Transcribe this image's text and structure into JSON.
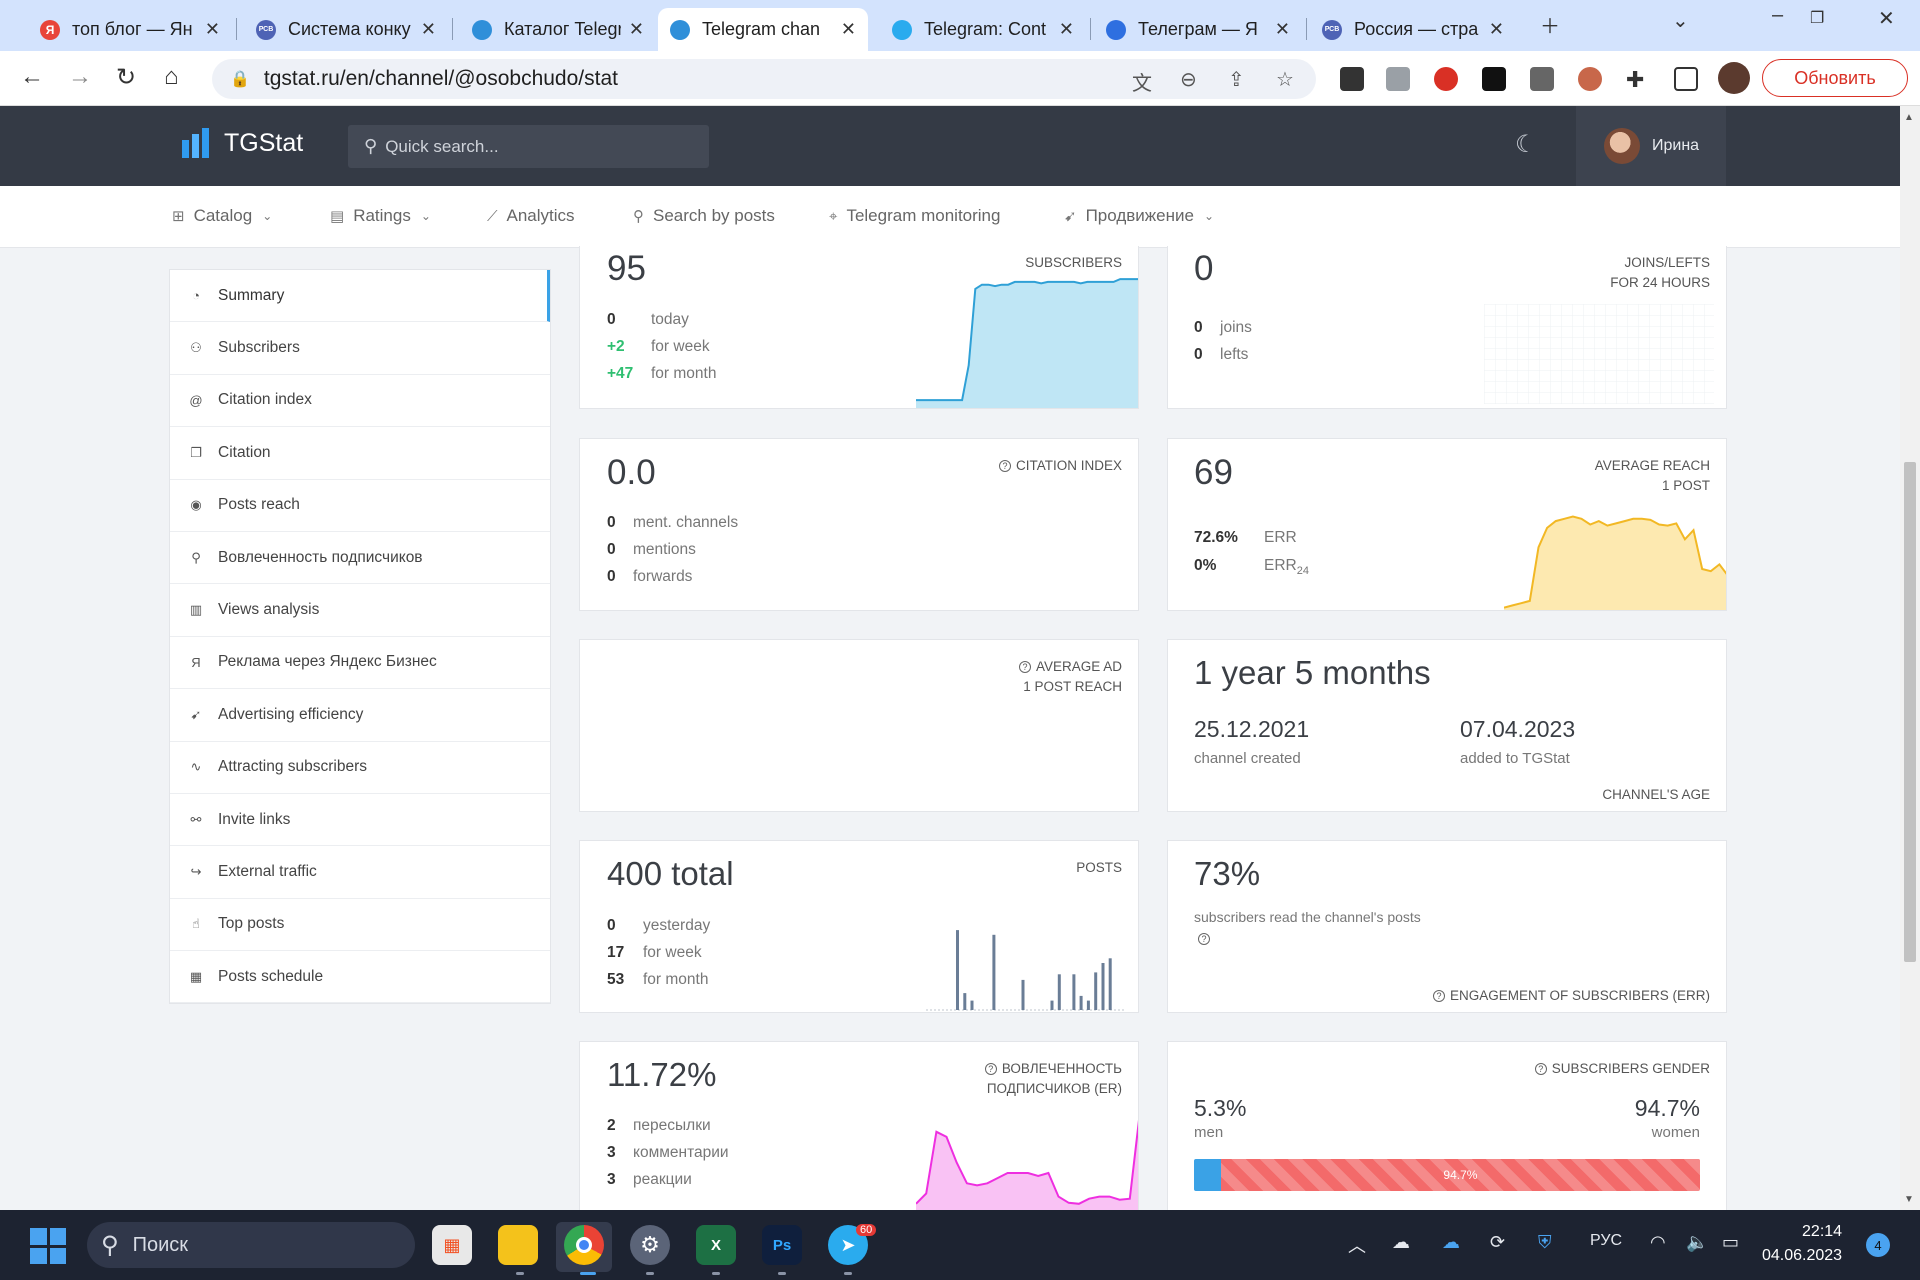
{
  "browser": {
    "tabs": [
      {
        "title": "топ блог — Ян",
        "icon": "yandex-icon",
        "color": "#e8443a",
        "glyph": "Я"
      },
      {
        "title": "Система конку",
        "icon": "rsv-icon",
        "color": "#4e63b5",
        "glyph": "РСВ"
      },
      {
        "title": "Каталог Telegr",
        "icon": "tgstat-icon",
        "color": "#2f8fd9",
        "glyph": ""
      },
      {
        "title": "Telegram chan",
        "icon": "tgstat-icon",
        "color": "#2f8fd9",
        "glyph": ""
      },
      {
        "title": "Telegram: Cont",
        "icon": "telegram-icon",
        "color": "#2aabee",
        "glyph": ""
      },
      {
        "title": "Телеграм — Я",
        "icon": "yandex-browser-icon",
        "color": "#2e6fe0",
        "glyph": ""
      },
      {
        "title": "Россия — стра",
        "icon": "rsv-icon",
        "color": "#4e63b5",
        "glyph": "РСВ"
      }
    ],
    "url": "tgstat.ru/en/channel/@osobchudo/stat",
    "update_label": "Обновить"
  },
  "header": {
    "logo": "TGStat",
    "search_placeholder": "Quick search...",
    "user_name": "Ирина"
  },
  "nav": [
    {
      "label": "Catalog",
      "icon": "grid-icon",
      "dropdown": true
    },
    {
      "label": "Ratings",
      "icon": "table-icon",
      "dropdown": true
    },
    {
      "label": "Analytics",
      "icon": "chart-icon",
      "dropdown": false
    },
    {
      "label": "Search by posts",
      "icon": "search-icon",
      "dropdown": false
    },
    {
      "label": "Telegram monitoring",
      "icon": "monitoring-icon",
      "dropdown": false
    },
    {
      "label": "Продвижение",
      "icon": "rocket-icon",
      "dropdown": true
    }
  ],
  "sidebar": [
    {
      "label": "Summary",
      "icon": "dashboard-icon",
      "glyph": "◔",
      "active": true
    },
    {
      "label": "Subscribers",
      "icon": "users-icon",
      "glyph": "⚇"
    },
    {
      "label": "Citation index",
      "icon": "at-icon",
      "glyph": "@"
    },
    {
      "label": "Citation",
      "icon": "quote-icon",
      "glyph": "❐"
    },
    {
      "label": "Posts reach",
      "icon": "eye-icon",
      "glyph": "◉"
    },
    {
      "label": "Вовлеченность подписчиков",
      "icon": "engagement-icon",
      "glyph": "⚲"
    },
    {
      "label": "Views analysis",
      "icon": "bar-chart-icon",
      "glyph": "▥"
    },
    {
      "label": "Реклама через Яндекс Бизнес",
      "icon": "yandex-icon",
      "glyph": "Я"
    },
    {
      "label": "Advertising efficiency",
      "icon": "rocket-icon",
      "glyph": "➹"
    },
    {
      "label": "Attracting subscribers",
      "icon": "trend-icon",
      "glyph": "∿"
    },
    {
      "label": "Invite links",
      "icon": "link-icon",
      "glyph": "⚯"
    },
    {
      "label": "External traffic",
      "icon": "share-icon",
      "glyph": "↪"
    },
    {
      "label": "Top posts",
      "icon": "thumbs-up-icon",
      "glyph": "☝"
    },
    {
      "label": "Posts schedule",
      "icon": "calendar-icon",
      "glyph": "▦"
    }
  ],
  "cards": {
    "subscribers": {
      "value": "95",
      "caption": "SUBSCRIBERS",
      "rows": [
        {
          "n": "0",
          "t": "today"
        },
        {
          "n": "+2",
          "t": "for week"
        },
        {
          "n": "+47",
          "t": "for month"
        }
      ]
    },
    "joins": {
      "value": "0",
      "caption1": "JOINS/LEFTS",
      "caption2": "FOR 24 HOURS",
      "rows": [
        {
          "n": "0",
          "t": "joins"
        },
        {
          "n": "0",
          "t": "lefts"
        }
      ]
    },
    "citation": {
      "value": "0.0",
      "caption": "CITATION INDEX",
      "rows": [
        {
          "n": "0",
          "t": "ment. channels"
        },
        {
          "n": "0",
          "t": "mentions"
        },
        {
          "n": "0",
          "t": "forwards"
        }
      ]
    },
    "reach": {
      "value": "69",
      "caption1": "AVERAGE REACH",
      "caption2": "1 POST",
      "err_value": "72.6%",
      "err_label": "ERR",
      "err24_value": "0%",
      "err24_label": "ERR",
      "err24_sub": "24"
    },
    "ad_reach": {
      "caption1": "AVERAGE AD",
      "caption2": "1 POST REACH"
    },
    "age": {
      "value": "1 year 5 months",
      "created_date": "25.12.2021",
      "created_label": "channel created",
      "added_date": "07.04.2023",
      "added_label": "added to TGStat",
      "caption": "CHANNEL'S AGE"
    },
    "posts": {
      "value": "400 total",
      "caption": "POSTS",
      "rows": [
        {
          "n": "0",
          "t": "yesterday"
        },
        {
          "n": "17",
          "t": "for week"
        },
        {
          "n": "53",
          "t": "for month"
        }
      ]
    },
    "err": {
      "value": "73%",
      "text": "subscribers read the channel's posts",
      "caption": "ENGAGEMENT OF SUBSCRIBERS (ERR)"
    },
    "er": {
      "value": "11.72%",
      "caption1": "ВОВЛЕЧЕННОСТЬ",
      "caption2": "ПОДПИСЧИКОВ (ER)",
      "rows": [
        {
          "n": "2",
          "t": "пересылки"
        },
        {
          "n": "3",
          "t": "комментарии"
        },
        {
          "n": "3",
          "t": "реакции"
        }
      ]
    },
    "gender": {
      "caption": "SUBSCRIBERS GENDER",
      "men_value": "5.3%",
      "men_label": "men",
      "women_value": "94.7%",
      "women_label": "women",
      "bar_label": "94.7%",
      "men_fraction": 0.053
    }
  },
  "sparklines": {
    "subscribers": [
      0.05,
      0.05,
      0.05,
      0.05,
      0.05,
      0.05,
      0.05,
      0.05,
      0.3,
      0.85,
      0.88,
      0.88,
      0.87,
      0.88,
      0.88,
      0.9,
      0.9,
      0.9,
      0.9,
      0.89,
      0.9,
      0.9,
      0.9,
      0.9,
      0.9,
      0.89,
      0.9,
      0.9,
      0.9,
      0.9,
      0.9,
      0.92,
      0.92,
      0.92,
      0.92
    ],
    "reach": [
      0.02,
      0.04,
      0.06,
      0.08,
      0.55,
      0.72,
      0.78,
      0.8,
      0.82,
      0.8,
      0.75,
      0.78,
      0.74,
      0.76,
      0.78,
      0.8,
      0.8,
      0.79,
      0.75,
      0.74,
      0.76,
      0.62,
      0.7,
      0.36,
      0.34,
      0.4,
      0.3
    ],
    "posts": [
      0.85,
      0.18,
      0.1,
      0,
      0,
      0.8,
      0,
      0,
      0,
      0.32,
      0,
      0,
      0,
      0.1,
      0.38,
      0,
      0.38,
      0.15,
      0.1,
      0.4,
      0.5,
      0.55
    ],
    "er": [
      0.05,
      0.15,
      0.75,
      0.7,
      0.45,
      0.25,
      0.23,
      0.25,
      0.3,
      0.35,
      0.35,
      0.35,
      0.32,
      0.35,
      0.12,
      0.06,
      0.05,
      0.1,
      0.12,
      0.12,
      0.09,
      0.1,
      0.95
    ]
  },
  "taskbar": {
    "search_placeholder": "Поиск",
    "lang": "РУС",
    "time": "22:14",
    "date": "04.06.2023",
    "notifications": "4",
    "telegram_badge": "60"
  }
}
